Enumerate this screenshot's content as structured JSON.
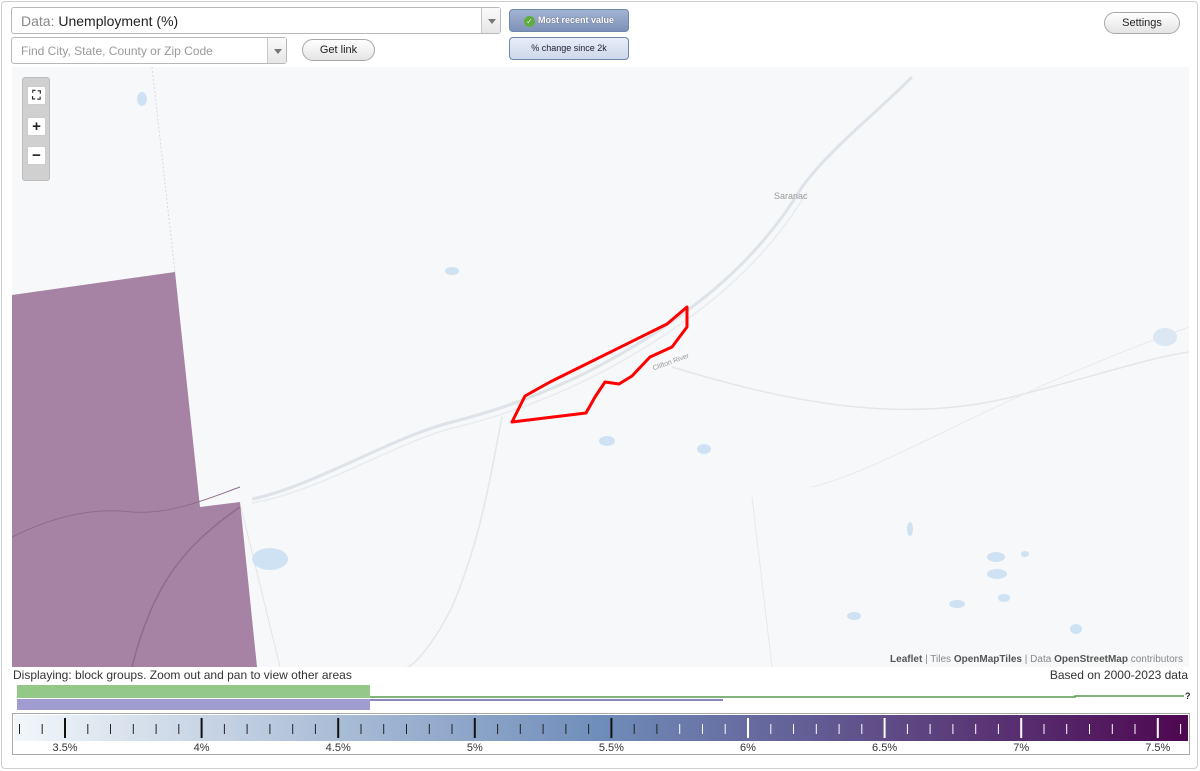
{
  "controls": {
    "data_prefix": "Data:",
    "data_value": "Unemployment (%)",
    "search_placeholder": "Find City, State, County or Zip Code",
    "get_link_label": "Get link",
    "most_recent_label": "Most recent value",
    "pct_change_label": "% change since 2k",
    "settings_label": "Settings"
  },
  "map": {
    "place_labels": [
      "Saranac"
    ],
    "road_label": "Clifton River",
    "attribution": {
      "leaflet": "Leaflet",
      "sep1": "|",
      "tiles_prefix": "Tiles",
      "tiles_source": "OpenMapTiles",
      "sep2": "|",
      "data_prefix": "Data",
      "data_source": "OpenStreetMap",
      "data_suffix": "contributors"
    },
    "highlight_color": "#ff0000",
    "shaded_area_color": "#a682a4"
  },
  "status_text": "Displaying: block groups. Zoom out and pan to view other areas",
  "based_on_text": "Based on 2000-2023 data",
  "histogram": {
    "unknown_marker": "?",
    "green_color": "#94c889",
    "blue_color": "#a09cd0"
  },
  "legend": {
    "ticks": [
      "3.5%",
      "4%",
      "4.5%",
      "5%",
      "5.5%",
      "6%",
      "6.5%",
      "7%",
      "7.5%"
    ],
    "color_low": "#f2f7fa",
    "color_mid": "#6f8dba",
    "color_high": "#4e0751"
  }
}
